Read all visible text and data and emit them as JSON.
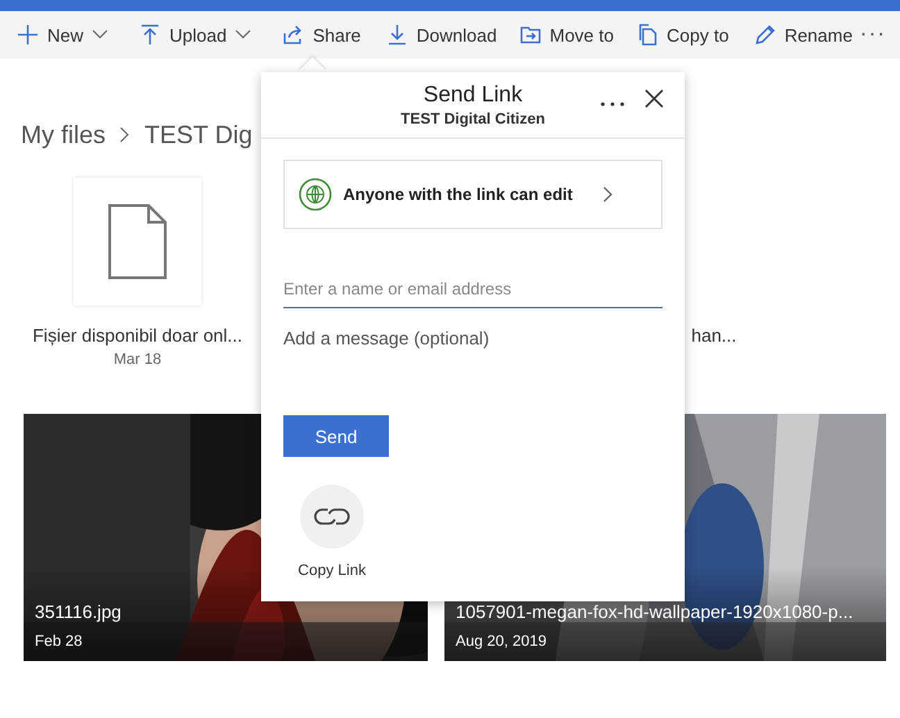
{
  "toolbar": [
    {
      "label": "New",
      "dropdown": true
    },
    {
      "label": "Upload",
      "dropdown": true
    },
    {
      "label": "Share",
      "dropdown": false
    },
    {
      "label": "Download",
      "dropdown": false
    },
    {
      "label": "Move to",
      "dropdown": false
    },
    {
      "label": "Copy to",
      "dropdown": false
    },
    {
      "label": "Rename",
      "dropdown": false
    }
  ],
  "toolbar_more": "···",
  "breadcrumb": [
    "My files",
    "TEST Dig"
  ],
  "files": [
    {
      "kind": "document",
      "name": "Fișier disponibil doar onl...",
      "date": "Mar 18"
    },
    {
      "kind": "hidden",
      "name": "han..."
    }
  ],
  "photos": [
    {
      "kind": "portrait",
      "name": "351116.jpg",
      "date": "Feb 28"
    },
    {
      "kind": "abstract",
      "name": "1057901-megan-fox-hd-wallpaper-1920x1080-p...",
      "date": "Aug 20, 2019"
    }
  ],
  "dialog": {
    "title": "Send Link",
    "subtitle": "TEST Digital Citizen",
    "permission": "Anyone with the link can edit",
    "recipient": {
      "placeholder": "Enter a name or email address"
    },
    "message": {
      "placeholder": "Add a message (optional)"
    },
    "send": "Send",
    "copy_link": "Copy Link"
  }
}
